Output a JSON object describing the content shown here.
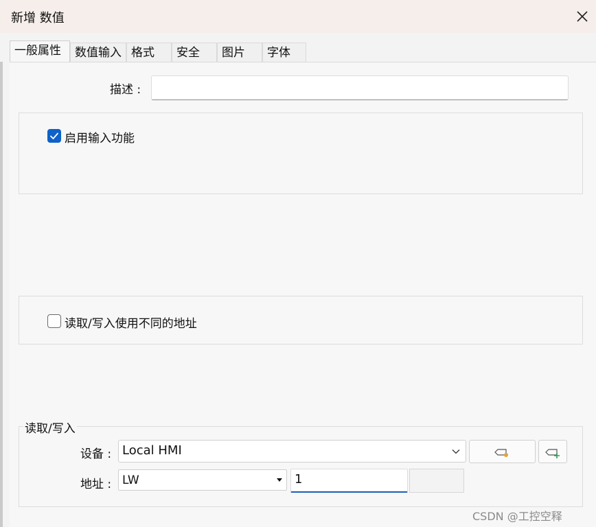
{
  "window": {
    "title": "新增 数值"
  },
  "tabs": [
    {
      "label": "一般属性",
      "active": true
    },
    {
      "label": "数值输入"
    },
    {
      "label": "格式"
    },
    {
      "label": "安全"
    },
    {
      "label": "图片"
    },
    {
      "label": "字体"
    }
  ],
  "general": {
    "description_label": "描述 :",
    "description_value": "",
    "enable_input_label": "启用输入功能",
    "enable_input_checked": true,
    "different_address_label": "读取/写入使用不同的地址",
    "different_address_checked": false
  },
  "read_write": {
    "group_title": "读取/写入",
    "device_label": "设备 :",
    "device_value": "Local HMI",
    "address_label": "地址 :",
    "address_type": "LW",
    "address_value": "1"
  },
  "watermark": "CSDN @工控空释",
  "colors": {
    "accent": "#0e62c9",
    "titlebar": "#f6eeea"
  }
}
